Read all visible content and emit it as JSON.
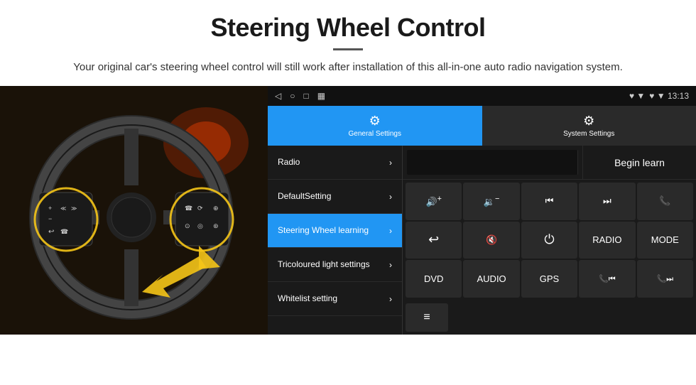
{
  "header": {
    "title": "Steering Wheel Control",
    "divider": true,
    "subtitle": "Your original car's steering wheel control will still work after installation of this all-in-one auto radio navigation system."
  },
  "status_bar": {
    "icons": [
      "◁",
      "○",
      "□",
      "▦"
    ],
    "right": "♥ ▼  13:13"
  },
  "tabs": [
    {
      "id": "general",
      "icon": "⚙",
      "label": "General Settings",
      "active": true
    },
    {
      "id": "system",
      "icon": "⚙",
      "label": "System Settings",
      "active": false
    }
  ],
  "menu": {
    "items": [
      {
        "id": "radio",
        "label": "Radio",
        "active": false
      },
      {
        "id": "default-setting",
        "label": "DefaultSetting",
        "active": false
      },
      {
        "id": "steering-wheel",
        "label": "Steering Wheel learning",
        "active": true
      },
      {
        "id": "tricoloured",
        "label": "Tricoloured light settings",
        "active": false
      },
      {
        "id": "whitelist",
        "label": "Whitelist setting",
        "active": false
      }
    ]
  },
  "controls": {
    "begin_learn_label": "Begin learn",
    "buttons_row1": [
      {
        "id": "vol-up",
        "icon": "🔊+",
        "label": "VOL+"
      },
      {
        "id": "vol-down",
        "icon": "🔉-",
        "label": "VOL-"
      },
      {
        "id": "prev",
        "icon": "⏮",
        "label": "PREV"
      },
      {
        "id": "next",
        "icon": "⏭",
        "label": "NEXT"
      },
      {
        "id": "phone",
        "icon": "📞",
        "label": "PHONE"
      }
    ],
    "buttons_row2": [
      {
        "id": "hook",
        "icon": "↩",
        "label": "HOOK"
      },
      {
        "id": "mute",
        "icon": "🔇",
        "label": "MUTE"
      },
      {
        "id": "power",
        "icon": "⏻",
        "label": "PWR"
      },
      {
        "id": "radio-btn",
        "icon": "RADIO",
        "label": "RADIO"
      },
      {
        "id": "mode",
        "icon": "MODE",
        "label": "MODE"
      }
    ],
    "buttons_row3": [
      {
        "id": "dvd",
        "label": "DVD"
      },
      {
        "id": "audio",
        "label": "AUDIO"
      },
      {
        "id": "gps",
        "label": "GPS"
      },
      {
        "id": "call-prev",
        "icon": "📞⏮",
        "label": "CALL-PREV"
      },
      {
        "id": "call-next",
        "icon": "📞⏭",
        "label": "CALL-NEXT"
      }
    ],
    "bottom_icon": "≡"
  }
}
